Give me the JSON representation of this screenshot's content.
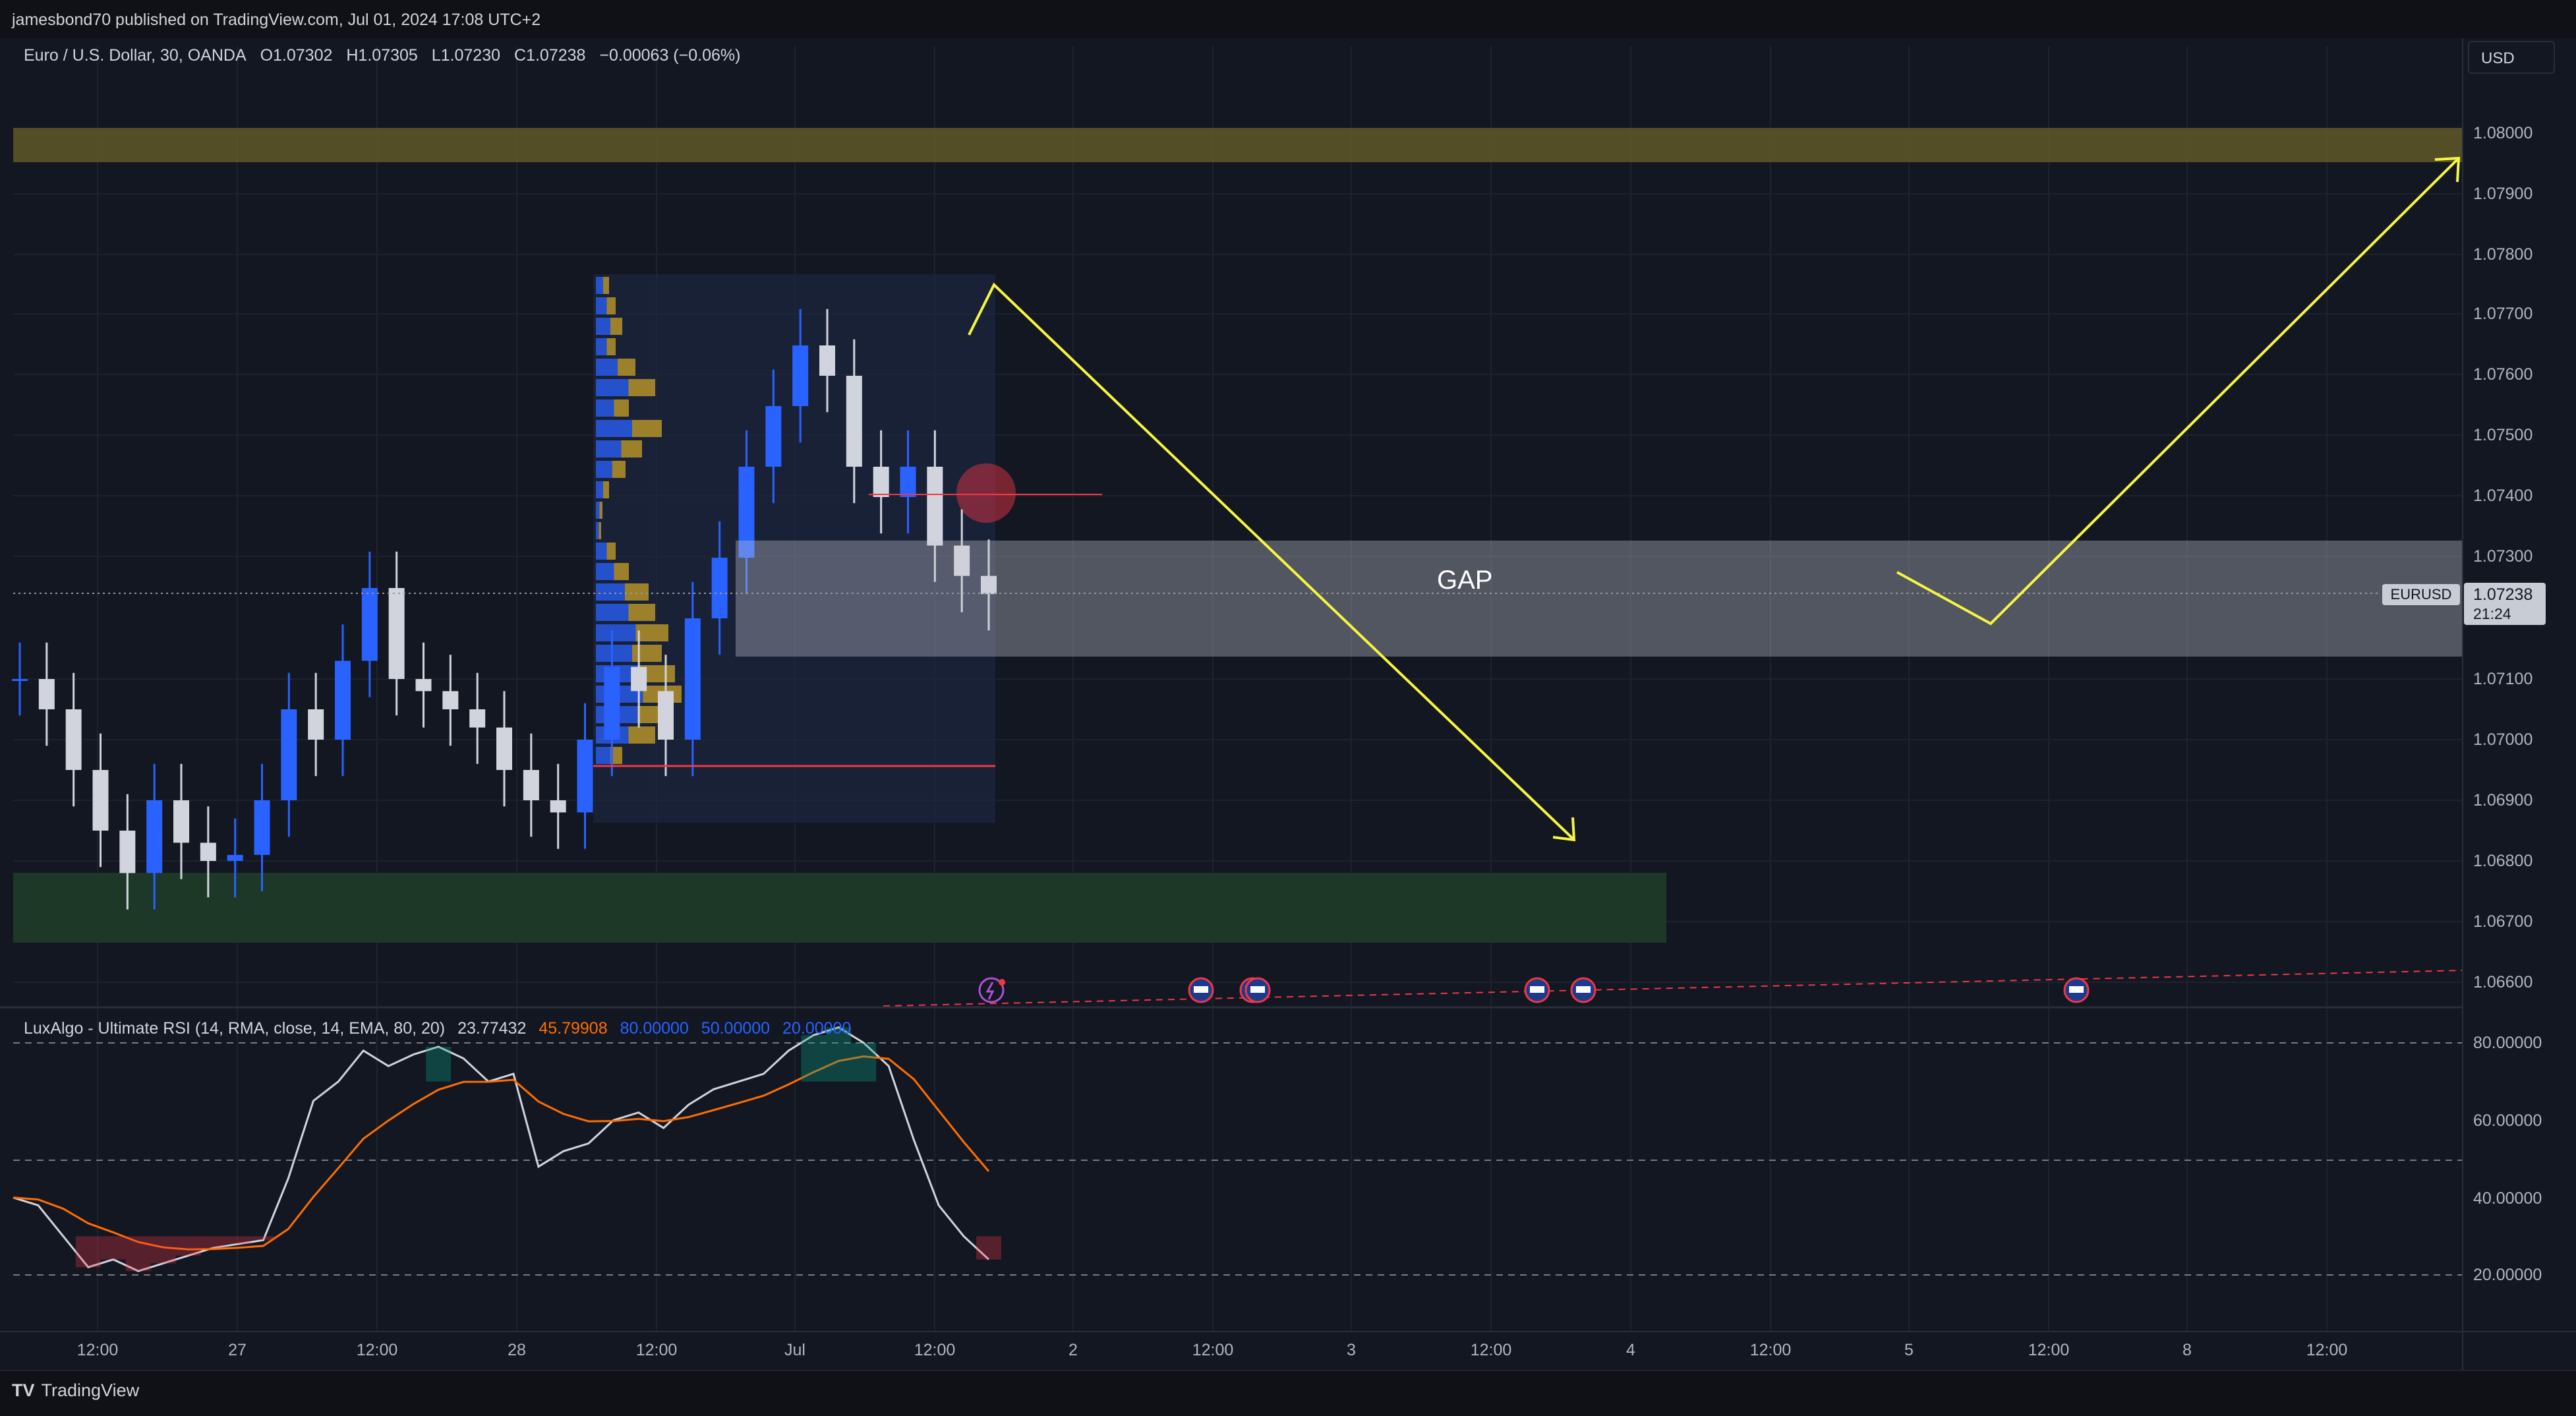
{
  "header": {
    "published_by": "jamesbond70 published on TradingView.com, Jul 01, 2024 17:08 UTC+2"
  },
  "legend": {
    "symbol_desc": "Euro / U.S. Dollar, 30, OANDA",
    "open": "O1.07302",
    "high": "H1.07305",
    "low": "L1.07230",
    "close": "C1.07238",
    "change": "−0.00063 (−0.06%)"
  },
  "currency": "USD",
  "annotations": {
    "gap_label": "GAP"
  },
  "price_tag": {
    "symbol": "EURUSD",
    "price": "1.07238",
    "countdown": "21:24"
  },
  "rsi_legend": {
    "name": "LuxAlgo - Ultimate RSI (14, RMA, close, 14, EMA, 80, 20)",
    "value1": "23.77432",
    "value2": "45.79908",
    "ob": "80.00000",
    "mid": "50.00000",
    "os": "20.00000"
  },
  "price_axis": [
    "1.08000",
    "1.07900",
    "1.07800",
    "1.07700",
    "1.07600",
    "1.07500",
    "1.07400",
    "1.07300",
    "1.07100",
    "1.07000",
    "1.06900",
    "1.06800",
    "1.06700",
    "1.06600"
  ],
  "rsi_axis": [
    "80.00000",
    "60.00000",
    "40.00000",
    "20.00000"
  ],
  "time_axis": [
    "12:00",
    "27",
    "12:00",
    "28",
    "12:00",
    "Jul",
    "12:00",
    "2",
    "12:00",
    "3",
    "12:00",
    "4",
    "12:00",
    "5",
    "12:00",
    "8",
    "12:00"
  ],
  "footer": {
    "brand": "TradingView"
  },
  "colors": {
    "bull": "#2962ff",
    "bear": "#d1d4dc",
    "resistance_zone": "#5c5428",
    "support_zone": "#1e3a28",
    "gap_zone": "#c8ccd4",
    "arrow": "#f5f542",
    "level_line": "#f23645",
    "rsi_line": "#d1d4dc",
    "rsi_signal": "#ff6d00"
  },
  "chart_data": {
    "type": "candlestick",
    "symbol": "EURUSD",
    "ylim": [
      1.0655,
      1.0805
    ],
    "candles_close_approx": [
      1.071,
      1.0705,
      1.0695,
      1.0685,
      1.0678,
      1.069,
      1.0683,
      1.068,
      1.0681,
      1.069,
      1.0705,
      1.07,
      1.0713,
      1.0725,
      1.071,
      1.0708,
      1.0705,
      1.0702,
      1.0695,
      1.069,
      1.0688,
      1.07,
      1.0712,
      1.0708,
      1.07,
      1.072,
      1.073,
      1.0745,
      1.0755,
      1.0765,
      1.076,
      1.0745,
      1.074,
      1.0745,
      1.0732,
      1.0727,
      1.0724
    ],
    "zones": [
      {
        "name": "resistance",
        "from": 1.0796,
        "to": 1.0802
      },
      {
        "name": "gap",
        "from": 1.0713,
        "to": 1.0732
      },
      {
        "name": "support",
        "from": 1.0667,
        "to": 1.0678
      }
    ],
    "rsi": {
      "levels": [
        80,
        50,
        20
      ],
      "ylim": [
        8,
        88
      ],
      "values_approx": [
        40,
        38,
        30,
        22,
        24,
        21,
        23,
        25,
        27,
        28,
        29,
        45,
        65,
        70,
        78,
        74,
        77,
        79,
        76,
        70,
        72,
        48,
        52,
        54,
        60,
        62,
        58,
        64,
        68,
        70,
        72,
        78,
        82,
        84,
        80,
        74,
        55,
        38,
        30,
        24
      ]
    }
  }
}
